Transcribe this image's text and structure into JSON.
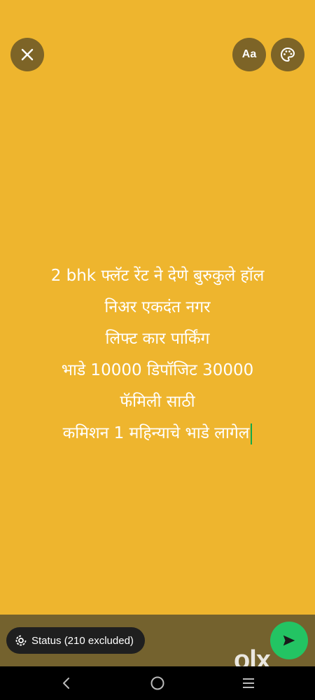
{
  "toolbar": {
    "font_label": "Aa"
  },
  "status": {
    "lines": [
      "2 bhk फ्लॅट रेंट ने देणे बुरुकुले हॉल",
      "निअर एकदंत नगर",
      "लिफ्ट कार पार्किंग",
      "भाडे 10000 डिपॉजिट 30000",
      "फॅमिली साठी",
      "कमिशन 1 महिन्याचे भाडे लागेल"
    ]
  },
  "footer": {
    "audience_label": "Status (210 excluded)",
    "watermark": "olx"
  },
  "colors": {
    "background": "#EEB52E",
    "button_bg": "#7D6427",
    "bottom_bar": "#74622E",
    "send_button": "#23C463",
    "cursor": "#12A94B"
  },
  "icons": {
    "close": "close-icon",
    "palette": "palette-icon",
    "audience": "status-circle-icon",
    "send": "send-icon",
    "nav_back": "back-icon",
    "nav_home": "home-icon",
    "nav_recent": "recent-apps-icon"
  }
}
